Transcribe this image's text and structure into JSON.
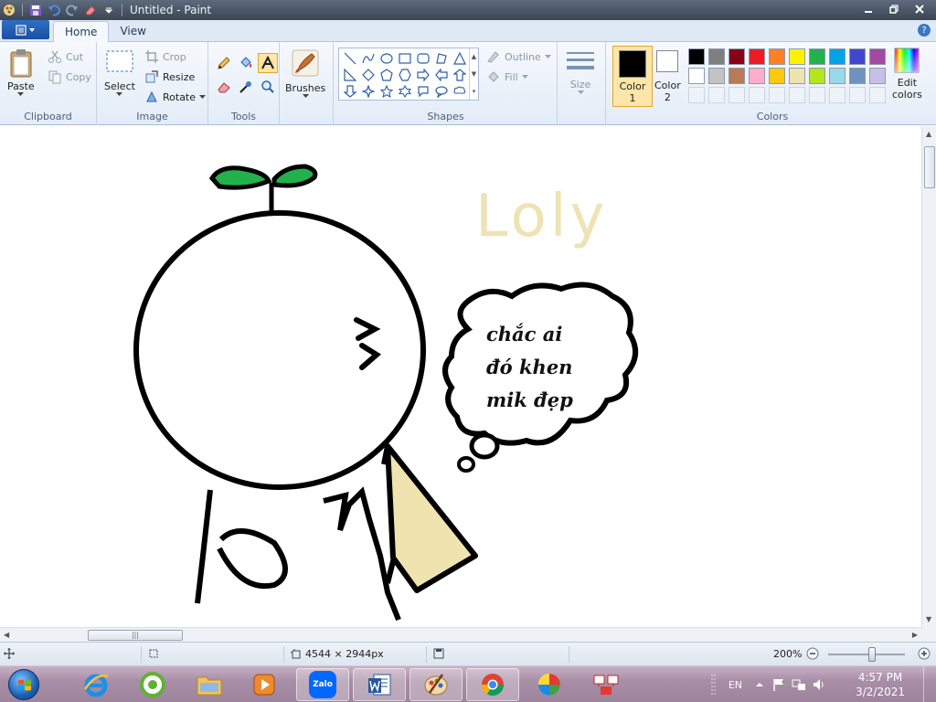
{
  "window": {
    "title": "Untitled - Paint"
  },
  "tabs": [
    {
      "label": "Home"
    },
    {
      "label": "View"
    }
  ],
  "ribbon": {
    "clipboard": {
      "label": "Clipboard",
      "paste": "Paste",
      "cut": "Cut",
      "copy": "Copy"
    },
    "image": {
      "label": "Image",
      "select": "Select",
      "crop": "Crop",
      "resize": "Resize",
      "rotate": "Rotate"
    },
    "tools": {
      "label": "Tools"
    },
    "brushes": {
      "label": "Brushes"
    },
    "shapes": {
      "label": "Shapes",
      "outline": "Outline",
      "fill": "Fill"
    },
    "size": {
      "label": "Size"
    },
    "colors": {
      "label": "Colors",
      "color1_line1": "Color",
      "color1_line2": "1",
      "color2_line1": "Color",
      "color2_line2": "2",
      "edit_line1": "Edit",
      "edit_line2": "colors",
      "color1": "#000000",
      "color2": "#ffffff",
      "palette_row1": [
        "#000000",
        "#7f7f7f",
        "#880015",
        "#ed1c24",
        "#ff7f27",
        "#fff200",
        "#22b14c",
        "#00a2e8",
        "#3f48cc",
        "#a349a4"
      ],
      "palette_row2": [
        "#ffffff",
        "#c3c3c3",
        "#b97a57",
        "#ffaec9",
        "#ffc90e",
        "#efe4b0",
        "#b5e61d",
        "#99d9ea",
        "#7092be",
        "#c8bfe7"
      ]
    }
  },
  "canvas": {
    "handwritten_title": "Loly",
    "bubble_lines": [
      "chắc ai",
      "đó khen",
      "mik đẹp"
    ]
  },
  "status": {
    "dimensions": "4544 × 2944px",
    "zoom": "200%"
  },
  "taskbar": {
    "language": "EN",
    "time": "4:57 PM",
    "date": "3/2/2021",
    "zalo_label": "Zalo"
  }
}
